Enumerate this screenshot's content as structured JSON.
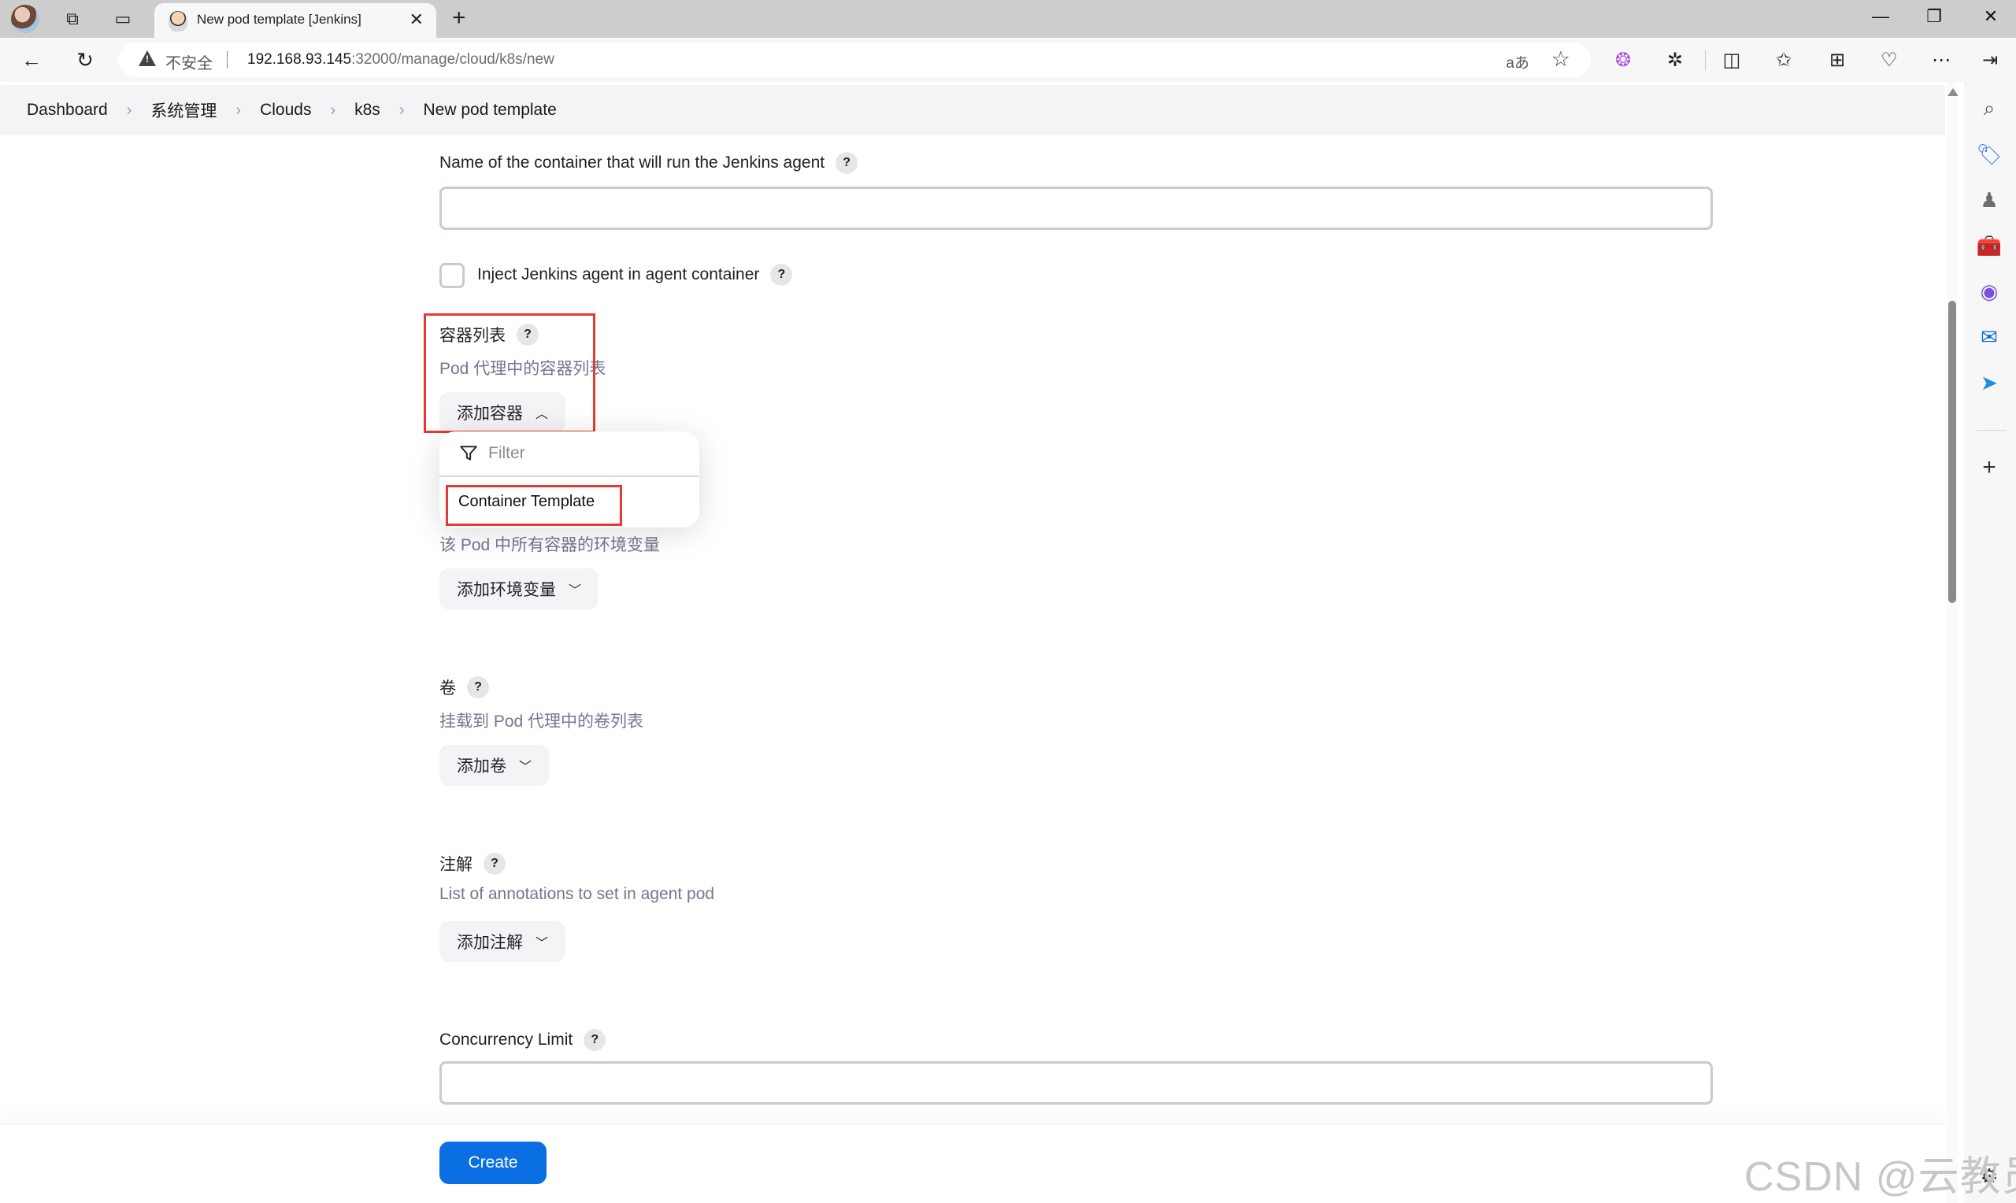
{
  "browser": {
    "tab_title": "New pod template [Jenkins]",
    "new_tab_symbol": "+",
    "address": {
      "security_label": "不安全",
      "host": "192.168.93.145",
      "path": ":32000/manage/cloud/k8s/new",
      "read_aloud_label": "aあ"
    },
    "toolbar_icons": [
      "copilot-icon",
      "extensions-icon",
      "split-screen-icon",
      "favorites-icon",
      "collections-icon",
      "browser-essentials-icon",
      "more-icon",
      "sidebar-toggle-icon"
    ],
    "sidebar_icons": [
      "search-icon",
      "shopping-tag-icon",
      "games-icon",
      "tools-icon",
      "office-icon",
      "outlook-icon",
      "telegram-icon",
      "add-icon"
    ]
  },
  "breadcrumb": {
    "items": [
      "Dashboard",
      "系统管理",
      "Clouds",
      "k8s",
      "New pod template"
    ]
  },
  "form": {
    "container_name": {
      "label": "Name of the container that will run the Jenkins agent",
      "value": ""
    },
    "inject_agent": {
      "label": "Inject Jenkins agent in agent container",
      "checked": false
    },
    "containers": {
      "label": "容器列表",
      "description": "Pod 代理中的容器列表",
      "add_button": "添加容器",
      "dropdown": {
        "filter_placeholder": "Filter",
        "items": [
          "Container Template"
        ]
      }
    },
    "env_vars": {
      "description": "该 Pod 中所有容器的环境变量",
      "add_button": "添加环境变量"
    },
    "volumes": {
      "label": "卷",
      "description": "挂载到 Pod 代理中的卷列表",
      "add_button": "添加卷"
    },
    "annotations": {
      "label": "注解",
      "description": "List of annotations to set in agent pod",
      "add_button": "添加注解"
    },
    "concurrency_limit": {
      "label": "Concurrency Limit",
      "value": ""
    },
    "help_symbol": "?"
  },
  "footer": {
    "create_button": "Create"
  },
  "watermark": "CSDN @云教员",
  "colors": {
    "primary": "#0b6fe4",
    "highlight": "#e53935",
    "description_text": "#757592"
  }
}
